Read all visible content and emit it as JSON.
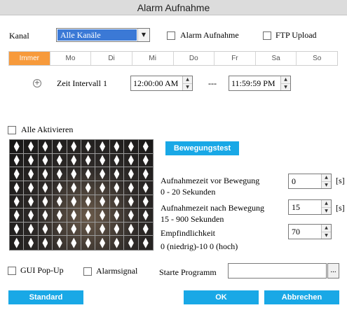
{
  "window": {
    "title": "Alarm Aufnahme"
  },
  "kanal": {
    "label": "Kanal",
    "value": "Alle Kanäle"
  },
  "alarm_aufnahme": {
    "label": "Alarm Aufnahme",
    "checked": false
  },
  "ftp_upload": {
    "label": "FTP Upload",
    "checked": false
  },
  "days": [
    "Immer",
    "Mo",
    "Di",
    "Mi",
    "Do",
    "Fr",
    "Sa",
    "So"
  ],
  "active_day": "Immer",
  "interval": {
    "label": "Zeit Intervall 1",
    "start": "12:00:00 AM",
    "separator": "---",
    "end": "11:59:59 PM"
  },
  "alle_aktivieren": {
    "label": "Alle Aktivieren",
    "checked": false
  },
  "bewegungstest_label": "Bewegungstest",
  "motion_grid": {
    "cols": 10,
    "rows": 8
  },
  "vor_bewegung": {
    "label": "Aufnahmezeit vor Bewegung",
    "range": "0 - 20 Sekunden",
    "value": "0",
    "unit": "[s]"
  },
  "nach_bewegung": {
    "label": "Aufnahmezeit nach Bewegung",
    "range": "15 - 900 Sekunden",
    "value": "15",
    "unit": "[s]"
  },
  "empfindlichkeit": {
    "label": "Empfindlichkeit",
    "range": "0 (niedrig)-10 0 (hoch)",
    "value": "70"
  },
  "gui_popup": {
    "label": "GUI Pop-Up",
    "checked": false
  },
  "alarmsignal": {
    "label": "Alarmsignal",
    "checked": false
  },
  "starte_programm": {
    "label": "Starte Programm",
    "value": "",
    "browse_label": "..."
  },
  "buttons": {
    "standard": "Standard",
    "ok": "OK",
    "abbrechen": "Abbrechen"
  },
  "colors": {
    "accent": "#19a8e6",
    "active_day": "#f79a3b",
    "select_highlight": "#3b79d6"
  },
  "icons": {
    "add_interval": "add-circle-icon",
    "dropdown": "chevron-down-icon",
    "spin": "spin-arrows-icon"
  }
}
